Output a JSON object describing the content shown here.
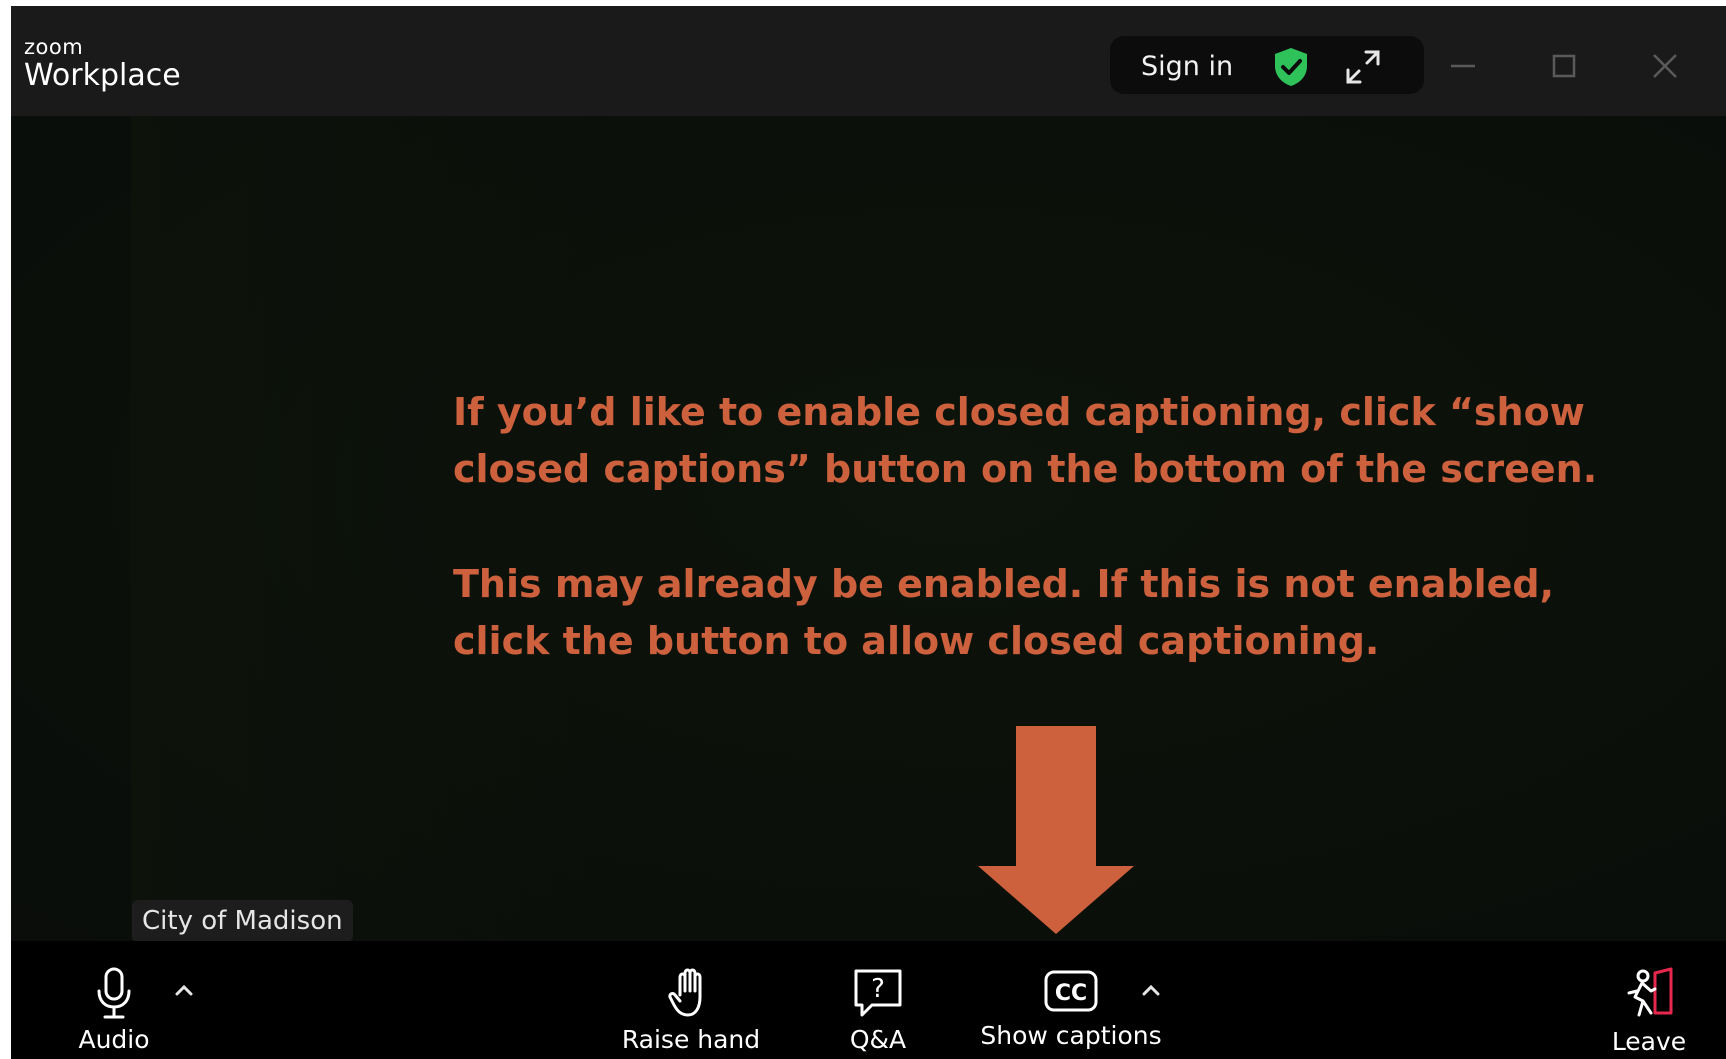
{
  "app": {
    "brand_top": "zoom",
    "brand_bottom": "Workplace"
  },
  "titlebar": {
    "sign_in_label": "Sign in",
    "icons": [
      "shield-check-icon",
      "expand-icon",
      "minimize-icon",
      "maximize-icon",
      "close-icon"
    ],
    "shield_color": "#2fc25b"
  },
  "video": {
    "message_line1": "If you’d like to enable closed captioning, click “show",
    "message_line2": "closed captions” button on the bottom of the screen.",
    "message_line3": "This may already be enabled. If this is not enabled,",
    "message_line4": "click the button to allow closed captioning.",
    "message_color": "#cd613d",
    "participant_name": "City of Madison"
  },
  "toolbar": {
    "audio_label": "Audio",
    "raise_hand_label": "Raise hand",
    "qa_label": "Q&A",
    "show_captions_label": "Show captions",
    "leave_label": "Leave",
    "leave_accent": "#e8274f"
  }
}
